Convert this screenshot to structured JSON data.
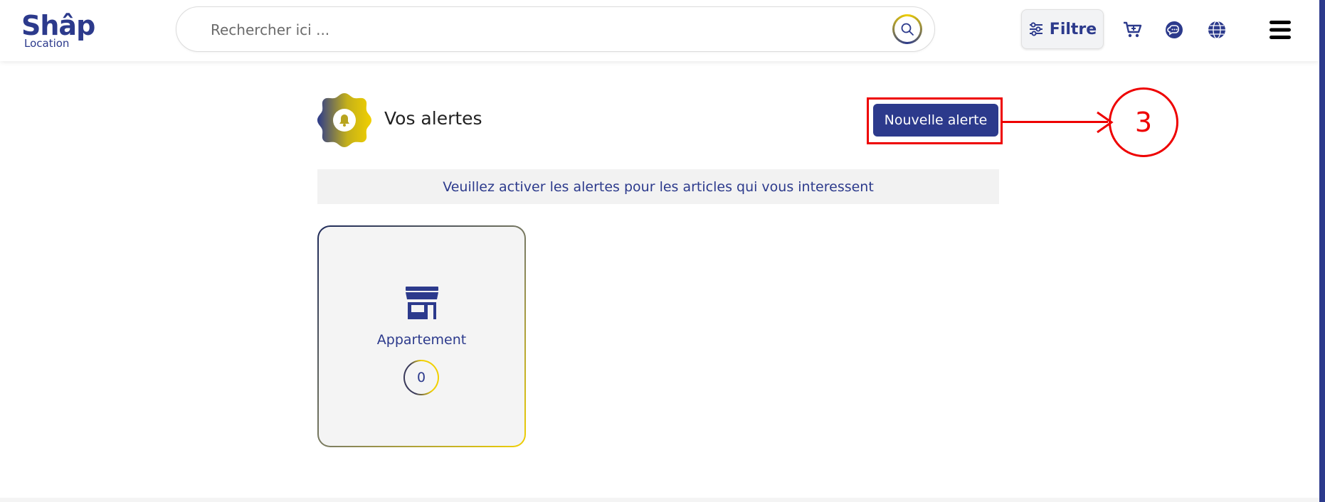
{
  "app": {
    "logo_main": "Shâp",
    "logo_sub": "Location"
  },
  "search": {
    "placeholder": "Rechercher ici ..."
  },
  "header": {
    "filter_label": "Filtre",
    "icons": [
      "cart-icon",
      "chat-icon",
      "globe-icon",
      "menu-icon"
    ]
  },
  "main": {
    "title": "Vos alertes",
    "new_alert_label": "Nouvelle alerte",
    "notice": "Veuillez activer les alertes pour les articles qui vous interessent",
    "categories": [
      {
        "label": "Appartement",
        "count": "0",
        "icon": "store-icon"
      }
    ]
  },
  "annotation": {
    "step": "3"
  },
  "colors": {
    "brand_blue": "#2c3a8c",
    "accent_yellow": "#f1d000",
    "annotation_red": "#ee0000"
  }
}
